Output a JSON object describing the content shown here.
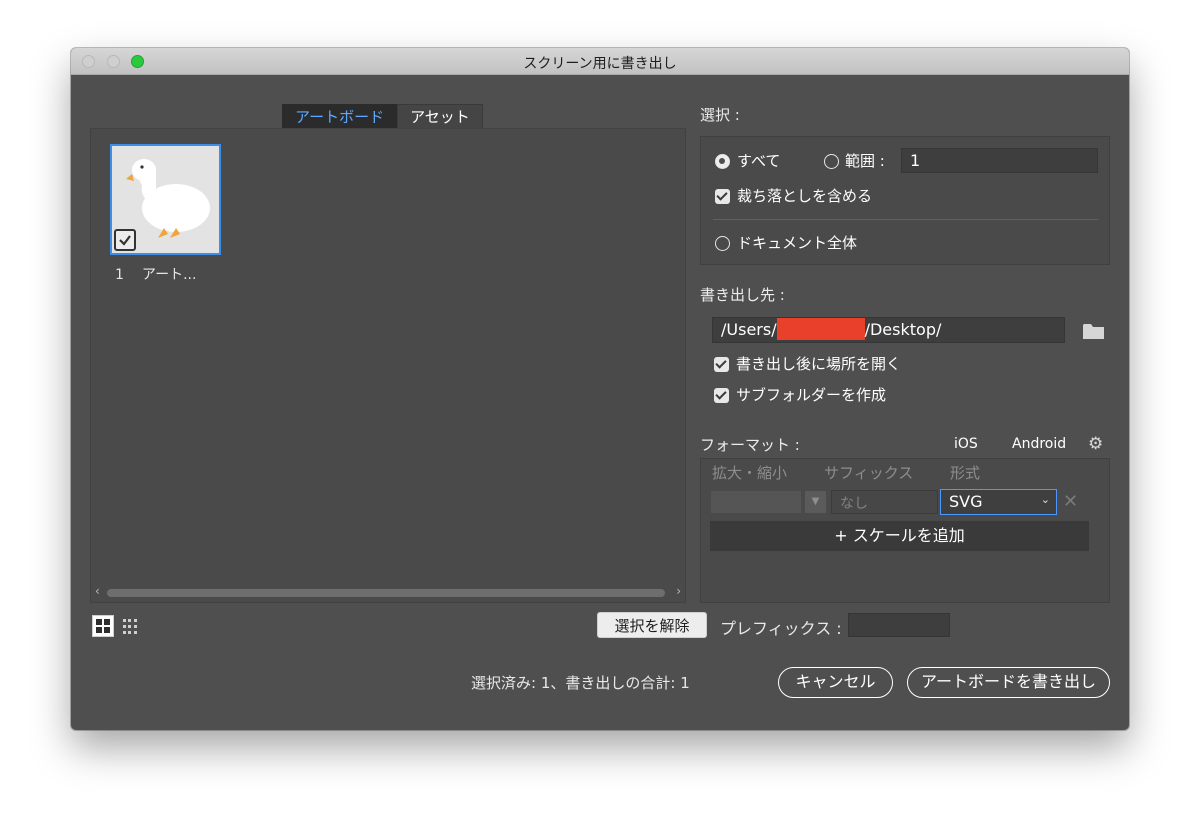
{
  "window": {
    "title": "スクリーン用に書き出し"
  },
  "tabs": [
    {
      "label": "アートボード",
      "active": true
    },
    {
      "label": "アセット",
      "active": false
    }
  ],
  "artboards": [
    {
      "number": "1",
      "name": "アート..."
    }
  ],
  "selection": {
    "label": "選択 :",
    "all_label": "すべて",
    "range_label": "範囲 :",
    "range_value": "1",
    "include_bleed_label": "裁ち落としを含める",
    "whole_document_label": "ドキュメント全体"
  },
  "export_to": {
    "label": "書き出し先 :",
    "path_prefix": "/Users/",
    "path_suffix": "/Desktop/",
    "open_after_label": "書き出し後に場所を開く",
    "create_subfolder_label": "サブフォルダーを作成"
  },
  "format": {
    "label": "フォーマット :",
    "ios_label": "iOS",
    "android_label": "Android",
    "col_scale": "拡大・縮小",
    "col_suffix": "サフィックス",
    "col_format": "形式",
    "suffix_placeholder": "なし",
    "format_value": "SVG",
    "add_scale_label": "+ スケールを追加"
  },
  "bottom": {
    "deselect_label": "選択を解除",
    "prefix_label": "プレフィックス :",
    "status": "選択済み: 1、書き出しの合計: 1",
    "cancel_label": "キャンセル",
    "export_label": "アートボードを書き出し"
  },
  "colors": {
    "accent_blue": "#3d8ee6",
    "redaction": "#e8402b",
    "maximize_green": "#2ac940"
  }
}
